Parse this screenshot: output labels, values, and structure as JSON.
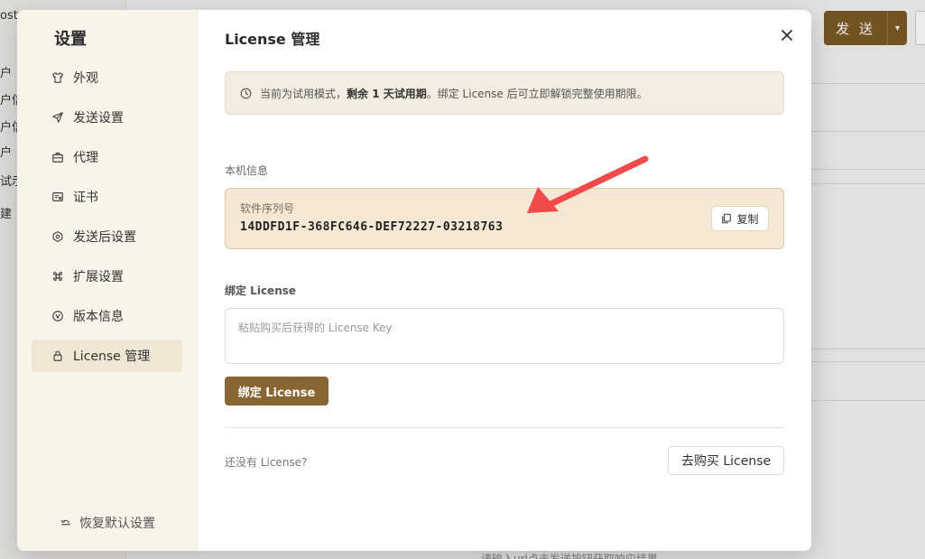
{
  "background": {
    "left_fragments": [
      "ost",
      "户",
      "户信",
      "户信",
      "户",
      "试示",
      "建"
    ],
    "send_label": "发 送",
    "bottom_hint": "请输入url点击发送按钮获取响应结果"
  },
  "sidebar": {
    "title": "设置",
    "items": [
      {
        "label": "外观",
        "icon": "shirt-icon"
      },
      {
        "label": "发送设置",
        "icon": "send-icon"
      },
      {
        "label": "代理",
        "icon": "briefcase-icon"
      },
      {
        "label": "证书",
        "icon": "certificate-icon"
      },
      {
        "label": "发送后设置",
        "icon": "hexagon-icon"
      },
      {
        "label": "扩展设置",
        "icon": "command-icon"
      },
      {
        "label": "版本信息",
        "icon": "version-icon"
      },
      {
        "label": "License 管理",
        "icon": "lock-icon"
      }
    ],
    "reset_label": "恢复默认设置"
  },
  "main": {
    "title": "License 管理",
    "trial": {
      "prefix": "当前为试用模式，",
      "bold": "剩余 1 天试用期",
      "suffix": "。绑定 License 后可立即解锁完整使用期限。"
    },
    "machine_info_label": "本机信息",
    "serial": {
      "label": "软件序列号",
      "value": "14DDFD1F-368FC646-DEF72227-03218763",
      "copy_label": "复制"
    },
    "bind_section_label": "绑定 License",
    "license_placeholder": "粘贴购买后获得的 License Key",
    "bind_button": "绑定 License",
    "no_license_text": "还没有 License?",
    "buy_button": "去购买 License"
  },
  "colors": {
    "accent": "#8a6534",
    "sidebar_bg": "#f9f4ea",
    "serial_bg": "#f4e8d4",
    "annotation_arrow": "#f04a4a"
  }
}
